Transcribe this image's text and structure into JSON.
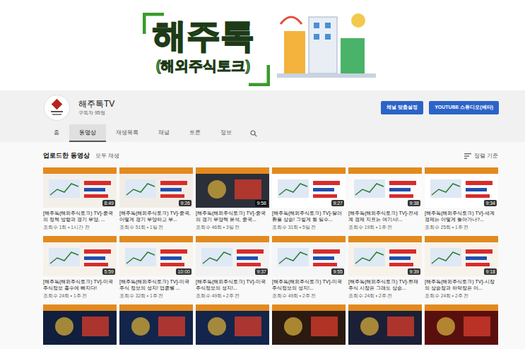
{
  "banner": {
    "title": "해주톡",
    "subtitle": "(해외주식토크)"
  },
  "channel": {
    "name": "해주톡TV",
    "subscribers": "구독자 95명"
  },
  "buttons": [
    "채널 맞춤설정",
    "YOUTUBE 스튜디오(베타)"
  ],
  "tabs": [
    {
      "label": "홈",
      "selected": false
    },
    {
      "label": "동영상",
      "selected": true
    },
    {
      "label": "재생목록",
      "selected": false
    },
    {
      "label": "채널",
      "selected": false
    },
    {
      "label": "토론",
      "selected": false
    },
    {
      "label": "정보",
      "selected": false
    }
  ],
  "section": {
    "title": "업로드한 동영상",
    "play_all": "모두 재생",
    "sort": "정렬 기준"
  },
  "videos": [
    {
      "title": "[해주톡(해외주식토크) TV]-중국의 정책 방향과 경기 부양, ...",
      "meta": "조회수 1회 • 1시간 전",
      "duration": "8:49"
    },
    {
      "title": "[해주톡(해외주식토크) TV]-중국, 어떻게 경기 부양하고 부...",
      "meta": "조회수 51회 • 1일 전",
      "duration": "9:26"
    },
    {
      "title": "[해주톡(해외주식토크) TV]-중국의 경기 부양책 분석, 중국...",
      "meta": "조회수 46회 • 3일 전",
      "duration": "9:58"
    },
    {
      "title": "[해주톡(해외주식토크) TV]-달러환율 상승! 그렇게 될 일수...",
      "meta": "조회수 31회 • 5일 전",
      "duration": "9:27"
    },
    {
      "title": "[해주톡(해외주식토크) TV]-전세계 경제 지표는 여기서!...",
      "meta": "조회수 19회 • 1주 전",
      "duration": "9:38"
    },
    {
      "title": "[해주톡(해외주식토크) TV]-세계 경제는 어떻게 돌아가나?...",
      "meta": "조회수 25회 • 1주 전",
      "duration": "9:34"
    },
    {
      "title": "[해주톡(해외주식토크) TV]-미국주식정보 홍수에 빠지다!",
      "meta": "조회수 24회 • 1주 전",
      "duration": "5:59"
    },
    {
      "title": "[해주톡(해외주식토크) TV]-미국주식 정보의 성지! 업종별 ...",
      "meta": "조회수 32회 • 1주 전",
      "duration": "10:00"
    },
    {
      "title": "[해주톡(해외주식토크) TV]-미국주식정보의 성지!...",
      "meta": "조회수 49회 • 2주 전",
      "duration": "9:37"
    },
    {
      "title": "[해주톡(해외주식토크) TV]-미국주식정보의 성지!...",
      "meta": "조회수 49회 • 2주 전",
      "duration": "9:55"
    },
    {
      "title": "[해주톡(해외주식토크) TV]-현재 주식 시장은 그래도 상승...",
      "meta": "조회수 24회 • 2주 전",
      "duration": "9:39"
    },
    {
      "title": "[해주톡(해외주식토크) TV]-시장의 상승장과 하락장은 어...",
      "meta": "조회수 24회 • 2주 전",
      "duration": "9:18"
    }
  ],
  "partial_videos": [
    {
      "cut_off": true
    },
    {
      "cut_off": true
    },
    {
      "cut_off": true
    },
    {
      "cut_off": true
    },
    {
      "cut_off": true
    },
    {
      "cut_off": true
    }
  ]
}
